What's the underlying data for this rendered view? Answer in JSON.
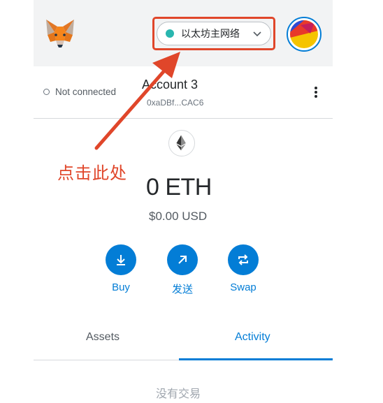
{
  "header": {
    "network_label": "以太坊主网络",
    "network_dot_color": "#29b6af",
    "logo_icon": "metamask-fox-icon",
    "avatar_icon": "account-avatar-icon"
  },
  "account": {
    "connection_status": "Not connected",
    "name": "Account 3",
    "address": "0xaDBf...CAC6",
    "menu_icon": "kebab-menu-icon"
  },
  "balance": {
    "token_icon": "ethereum-icon",
    "primary": "0 ETH",
    "secondary": "$0.00 USD"
  },
  "actions": [
    {
      "label": "Buy",
      "icon": "download-icon"
    },
    {
      "label": "发送",
      "icon": "arrow-up-right-icon"
    },
    {
      "label": "Swap",
      "icon": "swap-icon"
    }
  ],
  "tabs": {
    "assets": "Assets",
    "activity": "Activity",
    "active": "activity"
  },
  "activity": {
    "empty_text": "没有交易"
  },
  "annotation": {
    "callout_text": "点击此处",
    "color": "#e0462a"
  },
  "colors": {
    "accent": "#037dd6",
    "header_bg": "#f2f3f4"
  }
}
